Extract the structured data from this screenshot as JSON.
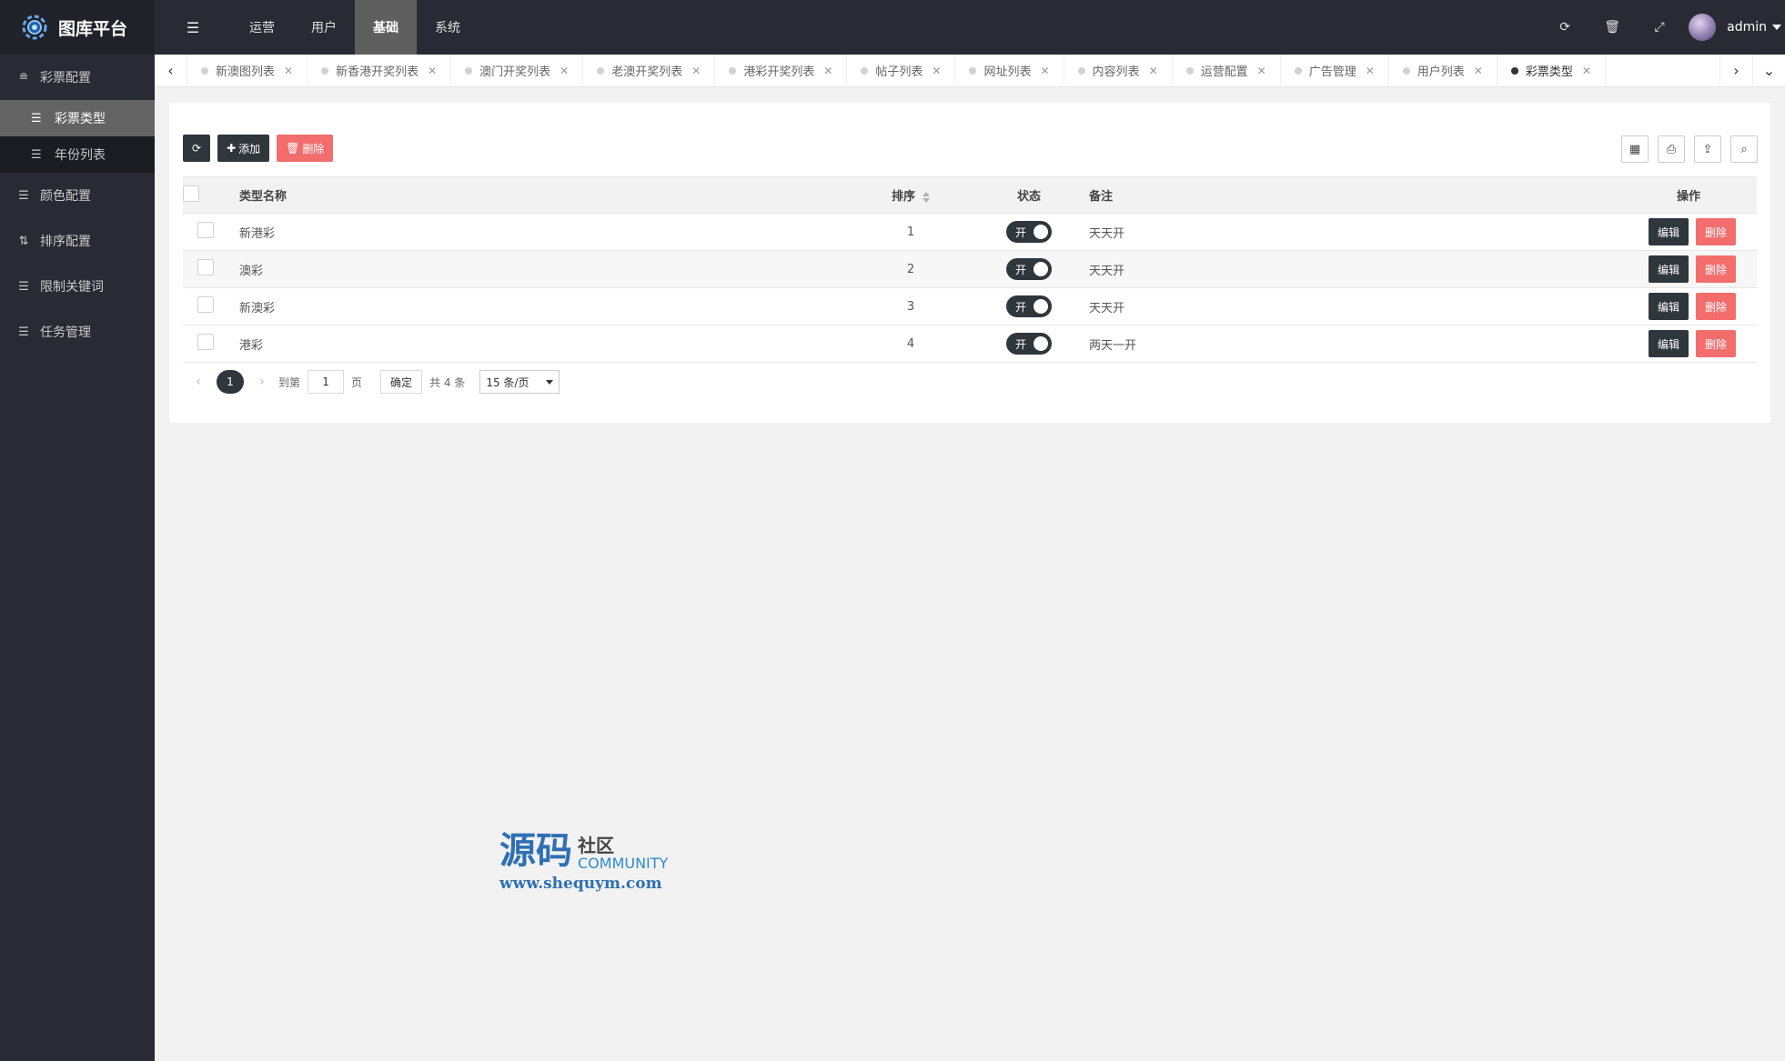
{
  "app": {
    "title": "图库平台"
  },
  "sidebar": {
    "groups": [
      {
        "label": "彩票配置",
        "icon": "layers-icon",
        "sub": [
          {
            "label": "彩票类型",
            "active": true
          },
          {
            "label": "年份列表",
            "active": false
          }
        ]
      },
      {
        "label": "颜色配置",
        "icon": "list-icon"
      },
      {
        "label": "排序配置",
        "icon": "sort-icon"
      },
      {
        "label": "限制关键词",
        "icon": "list-icon"
      },
      {
        "label": "任务管理",
        "icon": "list-icon"
      }
    ]
  },
  "header": {
    "nav": [
      "运营",
      "用户",
      "基础",
      "系统"
    ],
    "active_nav": "基础",
    "username": "admin"
  },
  "tabs": [
    "新澳图列表",
    "新香港开奖列表",
    "澳门开奖列表",
    "老澳开奖列表",
    "港彩开奖列表",
    "帖子列表",
    "网址列表",
    "内容列表",
    "运营配置",
    "广告管理",
    "用户列表",
    "彩票类型"
  ],
  "active_tab": "彩票类型",
  "toolbar": {
    "add_label": "添加",
    "delete_label": "删除"
  },
  "table": {
    "headers": {
      "name": "类型名称",
      "sort": "排序",
      "status": "状态",
      "note": "备注",
      "op": "操作"
    },
    "rows": [
      {
        "name": "新港彩",
        "sort": "1",
        "status": "开",
        "note": "天天开"
      },
      {
        "name": "澳彩",
        "sort": "2",
        "status": "开",
        "note": "天天开"
      },
      {
        "name": "新澳彩",
        "sort": "3",
        "status": "开",
        "note": "天天开"
      },
      {
        "name": "港彩",
        "sort": "4",
        "status": "开",
        "note": "两天一开"
      }
    ],
    "edit_label": "编辑",
    "delete_label": "删除"
  },
  "pager": {
    "current": "1",
    "goto_label": "到第",
    "page_input": "1",
    "page_label": "页",
    "ok_label": "确定",
    "total_label": "共 4 条",
    "page_size": "15 条/页"
  },
  "watermark": {
    "big": "源码",
    "cn": "社区",
    "en": "COMMUNITY",
    "url": "www.shequym.com"
  },
  "colors": {
    "sidebar": "#282b33",
    "dark_button": "#2f363c",
    "danger": "#f36d6d"
  }
}
